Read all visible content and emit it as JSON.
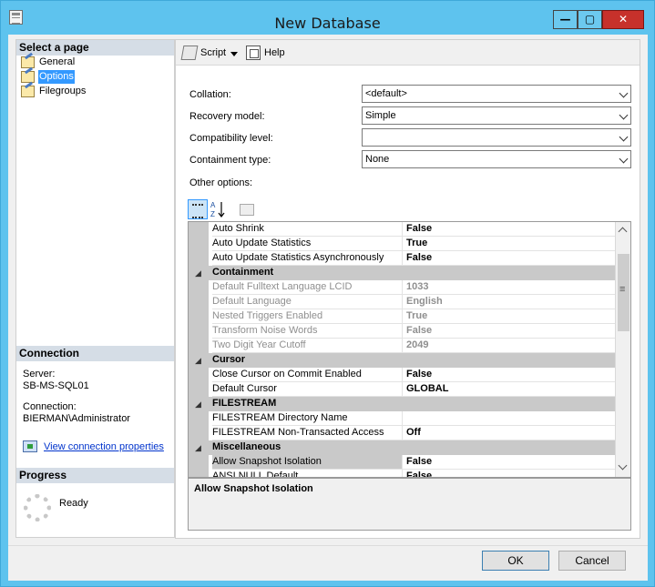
{
  "window": {
    "title": "New Database",
    "controls": {
      "minimize": "—",
      "maximize": "▢",
      "close": "✕"
    }
  },
  "left": {
    "select_page_header": "Select a page",
    "pages": [
      {
        "label": "General",
        "selected": false
      },
      {
        "label": "Options",
        "selected": true
      },
      {
        "label": "Filegroups",
        "selected": false
      }
    ],
    "connection_header": "Connection",
    "server_label": "Server:",
    "server_value": "SB-MS-SQL01",
    "connection_label": "Connection:",
    "connection_value": "BIERMAN\\Administrator",
    "view_connection_link": "View connection properties",
    "progress_header": "Progress",
    "progress_status": "Ready"
  },
  "toolbar": {
    "script_label": "Script",
    "help_label": "Help"
  },
  "form": {
    "collation_label": "Collation:",
    "collation_value": "<default>",
    "recovery_label": "Recovery model:",
    "recovery_value": "Simple",
    "compat_label": "Compatibility level:",
    "compat_value": "",
    "containment_label": "Containment type:",
    "containment_value": "None",
    "other_options_label": "Other options:"
  },
  "grid": {
    "rows": [
      {
        "kind": "prop",
        "name": "Auto Shrink",
        "value": "False",
        "disabled": false
      },
      {
        "kind": "prop",
        "name": "Auto Update Statistics",
        "value": "True",
        "disabled": false
      },
      {
        "kind": "prop",
        "name": "Auto Update Statistics Asynchronously",
        "value": "False",
        "disabled": false
      },
      {
        "kind": "cat",
        "name": "Containment",
        "toggle": "◢"
      },
      {
        "kind": "prop",
        "name": "Default Fulltext Language LCID",
        "value": "1033",
        "disabled": true
      },
      {
        "kind": "prop",
        "name": "Default Language",
        "value": "English",
        "disabled": true
      },
      {
        "kind": "prop",
        "name": "Nested Triggers Enabled",
        "value": "True",
        "disabled": true
      },
      {
        "kind": "prop",
        "name": "Transform Noise Words",
        "value": "False",
        "disabled": true
      },
      {
        "kind": "prop",
        "name": "Two Digit Year Cutoff",
        "value": "2049",
        "disabled": true
      },
      {
        "kind": "cat",
        "name": "Cursor",
        "toggle": "◢"
      },
      {
        "kind": "prop",
        "name": "Close Cursor on Commit Enabled",
        "value": "False",
        "disabled": false
      },
      {
        "kind": "prop",
        "name": "Default Cursor",
        "value": "GLOBAL",
        "disabled": false
      },
      {
        "kind": "cat",
        "name": "FILESTREAM",
        "toggle": "◢"
      },
      {
        "kind": "prop",
        "name": "FILESTREAM Directory Name",
        "value": "",
        "disabled": false
      },
      {
        "kind": "prop",
        "name": "FILESTREAM Non-Transacted Access",
        "value": "Off",
        "disabled": false
      },
      {
        "kind": "cat",
        "name": "Miscellaneous",
        "toggle": "◢"
      },
      {
        "kind": "prop",
        "name": "Allow Snapshot Isolation",
        "value": "False",
        "disabled": false,
        "selected": true
      },
      {
        "kind": "prop",
        "name": "ANSI NULL Default",
        "value": "False",
        "disabled": false
      }
    ]
  },
  "description": {
    "title": "Allow Snapshot Isolation"
  },
  "buttons": {
    "ok": "OK",
    "cancel": "Cancel"
  }
}
